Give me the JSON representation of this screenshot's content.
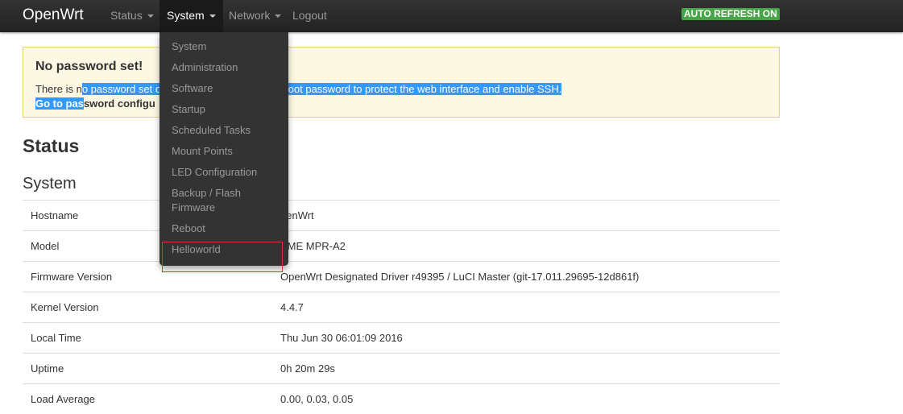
{
  "navbar": {
    "brand": "OpenWrt",
    "items": [
      {
        "label": "Status"
      },
      {
        "label": "System"
      },
      {
        "label": "Network"
      },
      {
        "label": "Logout"
      }
    ],
    "auto_refresh": "AUTO REFRESH ON",
    "auto_refresh_color": "#46a546"
  },
  "alert": {
    "title": "No password set!",
    "line1_pre": "There is n",
    "line1_selected": "o password set o",
    "line1_gap": "ure a root password to protect the web interface and enable SSH.",
    "line2_selected": "Go to pas",
    "line2_rest": "sword configu"
  },
  "page": {
    "title": "Status",
    "section": "System"
  },
  "system_info": [
    {
      "key": "Hostname",
      "value": "penWrt"
    },
    {
      "key": "Model",
      "value": "AME MPR-A2"
    },
    {
      "key": "Firmware Version",
      "value": "OpenWrt Designated Driver r49395 / LuCI Master (git-17.011.29695-12d861f)"
    },
    {
      "key": "Kernel Version",
      "value": "4.4.7"
    },
    {
      "key": "Local Time",
      "value": "Thu Jun 30 06:01:09 2016"
    },
    {
      "key": "Uptime",
      "value": "0h 20m 29s"
    },
    {
      "key": "Load Average",
      "value": "0.00, 0.03, 0.05"
    }
  ],
  "system_menu": [
    {
      "label": "System"
    },
    {
      "label": "Administration"
    },
    {
      "label": "Software"
    },
    {
      "label": "Startup"
    },
    {
      "label": "Scheduled Tasks"
    },
    {
      "label": "Mount Points"
    },
    {
      "label": "LED Configuration"
    },
    {
      "label": "Backup / Flash Firmware"
    },
    {
      "label": "Reboot"
    },
    {
      "label": "Helloworld"
    }
  ],
  "colors": {
    "navbar": "#222222",
    "alert_bg": "#fcf8e3",
    "selection": "#3399ff",
    "highlight_border": "#e03030"
  }
}
